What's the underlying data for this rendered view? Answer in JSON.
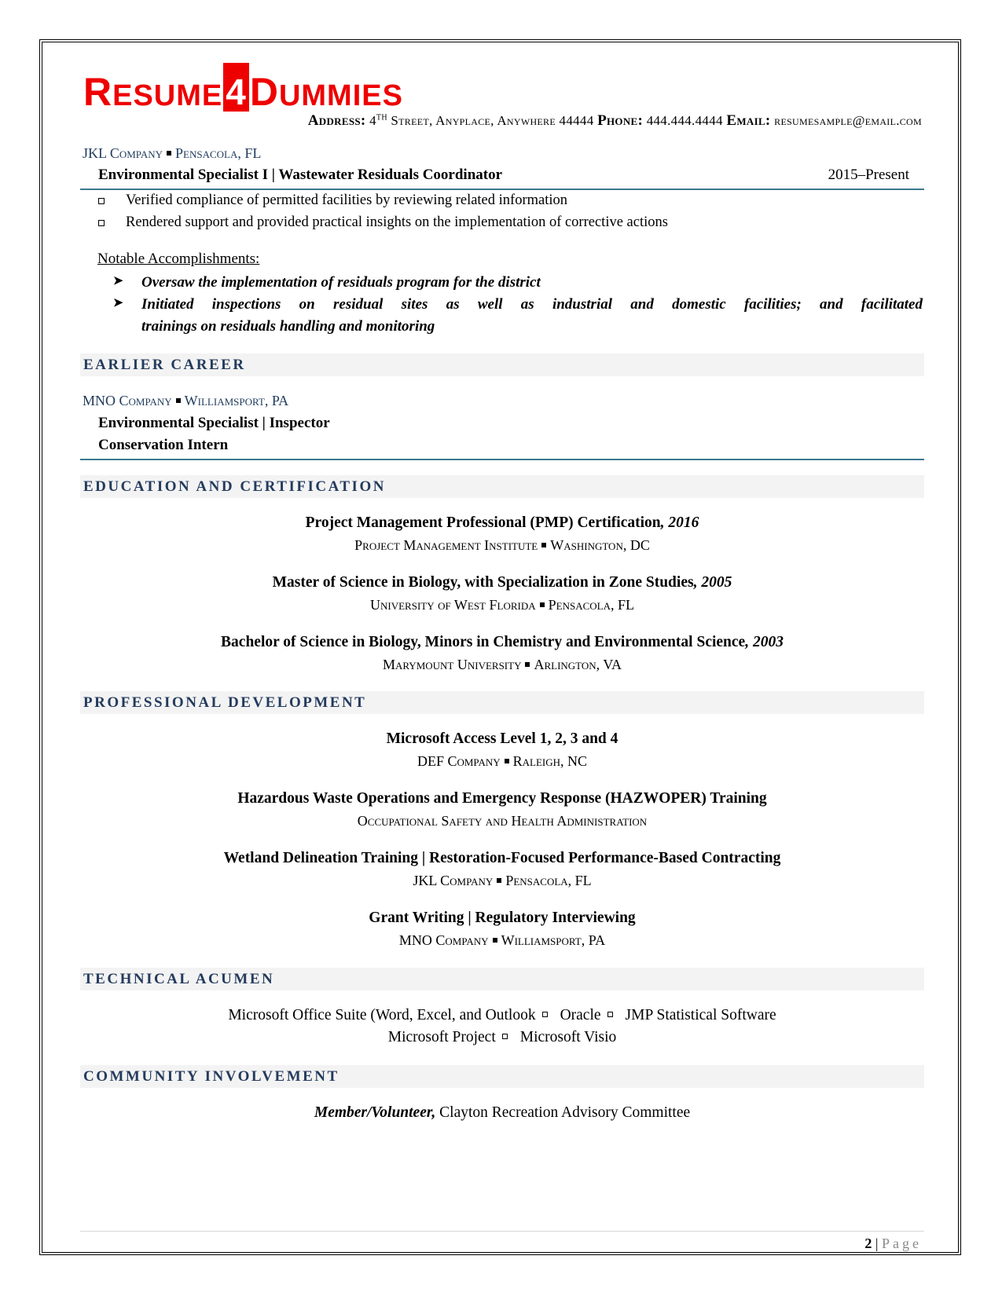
{
  "header": {
    "logo": {
      "part1_initial": "R",
      "part1_rest": "ESUME",
      "digit": "4",
      "part2_initial": "D",
      "part2_rest": "UMMIES"
    },
    "contact": {
      "address_label": "Address:",
      "address_num": "4",
      "address_sup": "TH",
      "address_rest": "Street, Anyplace, Anywhere 44444",
      "phone_label": "Phone:",
      "phone": "444.444.4444",
      "email_label": "Email:",
      "email": "resumesample@email.com"
    }
  },
  "current_job": {
    "company": "JKL Company",
    "location": "Pensacola, FL",
    "title": "Environmental Specialist I | Wastewater Residuals Coordinator",
    "dates": "2015–Present",
    "bullets": [
      "Verified compliance of permitted facilities by reviewing related information",
      "Rendered support and provided practical insights on the implementation of corrective actions"
    ],
    "accomplishments_label": "Notable Accomplishments:",
    "accomplishments": [
      "Oversaw the implementation of residuals program for the district",
      "Initiated inspections on residual sites as well as industrial and domestic facilities; and facilitated",
      "trainings on residuals handling and monitoring"
    ]
  },
  "earlier_career": {
    "heading": "EARLIER CAREER",
    "company": "MNO Company",
    "location": "Williamsport, PA",
    "titles": [
      "Environmental Specialist | Inspector",
      "Conservation Intern"
    ]
  },
  "education": {
    "heading": "EDUCATION AND CERTIFICATION",
    "entries": [
      {
        "title": "Project Management Professional (PMP) Certification",
        "year": ", 2016",
        "org": "Project Management Institute",
        "location": "Washington, DC"
      },
      {
        "title": "Master of Science in Biology, with Specialization in Zone Studies",
        "year": ", 2005",
        "org": "University of West Florida",
        "location": "Pensacola, FL"
      },
      {
        "title": "Bachelor of Science in Biology, Minors in Chemistry and Environmental Science",
        "year": ", 2003",
        "org": "Marymount University",
        "location": "Arlington, VA"
      }
    ]
  },
  "professional_development": {
    "heading": "PROFESSIONAL DEVELOPMENT",
    "entries": [
      {
        "title": "Microsoft Access Level 1, 2, 3 and 4",
        "org": "DEF Company",
        "location": "Raleigh, NC"
      },
      {
        "title": "Hazardous Waste Operations and Emergency Response (HAZWOPER) Training",
        "org": "Occupational Safety and Health Administration",
        "location": ""
      },
      {
        "title": "Wetland Delineation Training | Restoration-Focused Performance-Based Contracting",
        "org": "JKL Company",
        "location": "Pensacola, FL"
      },
      {
        "title": "Grant Writing | Regulatory Interviewing",
        "org": "MNO Company",
        "location": "Williamsport, PA"
      }
    ]
  },
  "technical_acumen": {
    "heading": "TECHNICAL ACUMEN",
    "line1": [
      "Microsoft Office Suite (Word, Excel, and Outlook",
      "Oracle",
      "JMP Statistical Software"
    ],
    "line2": [
      "Microsoft Project",
      "Microsoft Visio"
    ]
  },
  "community": {
    "heading": "COMMUNITY INVOLVEMENT",
    "role": "Member/Volunteer,",
    "organization": " Clayton Recreation Advisory Committee"
  },
  "footer": {
    "page_number": "2",
    "separator": " | ",
    "page_label": "Page"
  },
  "colors": {
    "brand_red": "#ee0000",
    "heading_navy": "#243b5e",
    "rule_teal": "#3b7a8f",
    "band_gray": "#f3f3f3"
  }
}
